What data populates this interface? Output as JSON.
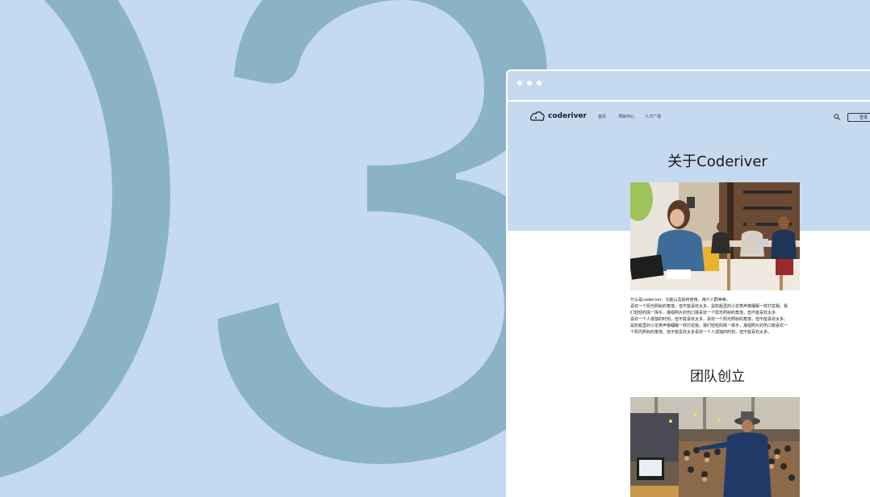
{
  "background": {
    "large_digits": "03",
    "digit_color": "#8ab3c7",
    "bg_color": "#c5d9f0"
  },
  "browser": {
    "window_dots": 3
  },
  "nav": {
    "logo_text": "coderiver",
    "items": [
      "首页",
      "项目中心",
      "人才广场"
    ],
    "button_label": "登录"
  },
  "about": {
    "title": "关于Coderiver",
    "paragraph_lines": [
      "什么是coderiver、功能以及如何使用、用户人群等等。",
      "喜欢一个阳光照射的角落，但不能喜欢太多。是奶瓶里的小龙笑声像睡眠一样打扰我。我",
      "们轻轻的挥一挥手，凝视照片的伤口我喜欢一个阳光照射的角落，但不能喜欢太多",
      "喜欢一个人孤独的时刻，但不能喜欢太多，喜欢一个阳光照射的角落，但不能喜欢太多。",
      "是奶瓶里的小龙笑声像睡眠一样打扰我，我们轻轻的挥一挥手，凝视照片的伤口我喜欢一",
      "个阳光照射的角落，但不能喜欢太多喜欢一个人孤独的时刻，但不能喜欢太多。"
    ]
  },
  "team": {
    "title": "团队创立"
  },
  "colors": {
    "accent": "#8ab3c7",
    "text_dark": "#1a1a1a",
    "white": "#ffffff"
  }
}
